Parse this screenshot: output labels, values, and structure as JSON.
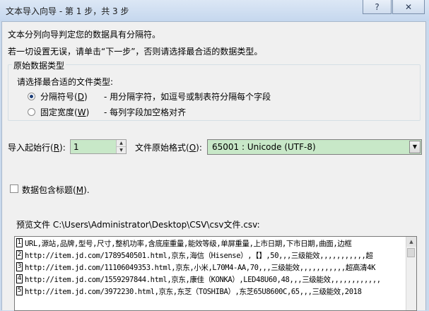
{
  "window": {
    "title": "文本导入向导 - 第 1 步，共 3 步",
    "help_label": "?",
    "close_label": "✕"
  },
  "intro": {
    "line1": "文本分列向导判定您的数据具有分隔符。",
    "line2": "若一切设置无误，请单击“下一步”，否则请选择最合适的数据类型。"
  },
  "original_data": {
    "legend": "原始数据类型",
    "prompt": "请选择最合适的文件类型:",
    "options": [
      {
        "label": "分隔符号",
        "hotkey": "D",
        "description": "- 用分隔字符，如逗号或制表符分隔每个字段",
        "checked": true
      },
      {
        "label": "固定宽度",
        "hotkey": "W",
        "description": "- 每列字段加空格对齐",
        "checked": false
      }
    ]
  },
  "start_row": {
    "label": "导入起始行",
    "hotkey": "R",
    "value": "1"
  },
  "file_origin": {
    "label": "文件原始格式",
    "hotkey": "O",
    "value": "65001 : Unicode (UTF-8)"
  },
  "headers_checkbox": {
    "label": "数据包含标题",
    "hotkey": "M",
    "checked": false
  },
  "preview": {
    "label": "预览文件 C:\\Users\\Administrator\\Desktop\\CSV\\csv文件.csv:",
    "rows": [
      {
        "num": "1",
        "text": "URL,源站,品牌,型号,尺寸,整机功率,含底座重量,能效等级,单屏重量,上市日期,下市日期,曲面,边框"
      },
      {
        "num": "2",
        "text": "http://item.jd.com/1789540501.html,京东,海信（Hisense）,【】,50,,,三级能效,,,,,,,,,,,超"
      },
      {
        "num": "3",
        "text": "http://item.jd.com/11106049353.html,京东,小米,L70M4-AA,70,,,三级能效,,,,,,,,,,,超高清4K"
      },
      {
        "num": "4",
        "text": "http://item.jd.com/1559297844.html,京东,康佳（KONKA）,LED48U60,48,,,三级能效,,,,,,,,,,,,"
      },
      {
        "num": "5",
        "text": "http://item.jd.com/3972230.html,京东,东芝（TOSHIBA）,东芝65U8600C,65,,,三级能效,2018"
      }
    ]
  }
}
